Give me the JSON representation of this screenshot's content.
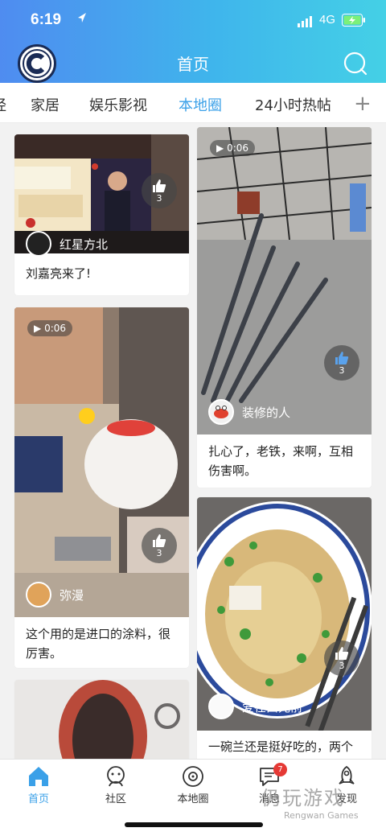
{
  "status_bar": {
    "time": "6:19",
    "network": "4G"
  },
  "header": {
    "title": "首页"
  },
  "tabs": [
    {
      "label": "经"
    },
    {
      "label": "家居"
    },
    {
      "label": "娱乐影视"
    },
    {
      "label": "本地圈",
      "active": true
    },
    {
      "label": "24小时热帖"
    }
  ],
  "tab_add": "+",
  "cards": [
    {
      "caption": "刘嘉亮来了!",
      "author": "红星方北",
      "likes": "3",
      "duration": ""
    },
    {
      "caption": "这个用的是进口的涂料，很厉害。",
      "author": "弥漫",
      "likes": "3",
      "duration": "0:06"
    },
    {
      "caption": "扎心了，老铁，来啊，互相伤害啊。",
      "author": "装修的人",
      "likes": "3",
      "duration": "0:06"
    },
    {
      "caption": "一碗兰还是挺好吃的，两个",
      "author": "爱在西元前",
      "likes": "3",
      "duration": ""
    }
  ],
  "bottom_nav": [
    {
      "label": "首页",
      "icon": "home-icon",
      "active": true
    },
    {
      "label": "社区",
      "icon": "community-icon"
    },
    {
      "label": "本地圈",
      "icon": "local-circle-icon"
    },
    {
      "label": "消息",
      "icon": "message-icon",
      "badge": "7"
    },
    {
      "label": "发现",
      "icon": "discover-rocket-icon"
    }
  ],
  "watermark": {
    "cn": "仍玩游戏",
    "en": "Rengwan Games"
  },
  "colors": {
    "accent": "#3aa0e8",
    "header_start": "#4f8cf0",
    "header_end": "#44d0e6",
    "badge": "#e53935"
  }
}
